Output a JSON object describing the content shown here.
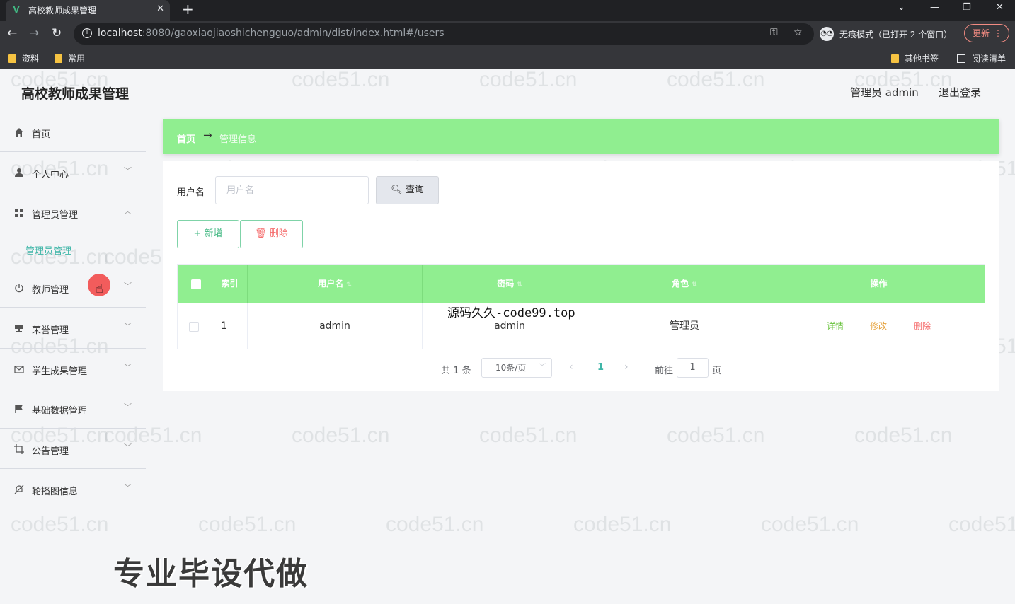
{
  "browser": {
    "tab_title": "高校教师成果管理",
    "tab_favicon": "V",
    "url_host": "localhost",
    "url_rest": ":8080/gaoxiaojiaoshichengguo/admin/dist/index.html#/users",
    "incognito_label": "无痕模式（已打开 2 个窗口）",
    "update_label": "更新",
    "bookmarks": [
      "资料",
      "常用",
      "其他书签",
      "阅读清单"
    ]
  },
  "header": {
    "title": "高校教师成果管理",
    "admin_label": "管理员 admin",
    "logout_label": "退出登录"
  },
  "sidebar": {
    "items": [
      {
        "label": "首页",
        "icon": "home-icon"
      },
      {
        "label": "个人中心",
        "icon": "user-icon"
      },
      {
        "label": "管理员管理",
        "icon": "grid-icon"
      },
      {
        "label": "教师管理",
        "icon": "power-icon"
      },
      {
        "label": "荣誉管理",
        "icon": "trophy-icon"
      },
      {
        "label": "学生成果管理",
        "icon": "mail-icon"
      },
      {
        "label": "基础数据管理",
        "icon": "flag-icon"
      },
      {
        "label": "公告管理",
        "icon": "crop-icon"
      },
      {
        "label": "轮播图信息",
        "icon": "bell-off-icon"
      }
    ],
    "sub_item": "管理员管理"
  },
  "breadcrumb": {
    "home": "首页",
    "arrow": "→",
    "current": "管理信息"
  },
  "search": {
    "label": "用户名",
    "placeholder": "用户名",
    "button": "查询"
  },
  "actions": {
    "add": "新增",
    "delete": "删除"
  },
  "table": {
    "columns": [
      "索引",
      "用户名",
      "密码",
      "角色",
      "操作"
    ],
    "rows": [
      {
        "index": "1",
        "username": "admin",
        "password": "admin",
        "role": "管理员"
      }
    ],
    "row_actions": {
      "detail": "详情",
      "edit": "修改",
      "delete": "删除"
    }
  },
  "pagination": {
    "total": "共 1 条",
    "page_size": "10条/页",
    "current_page": "1",
    "goto_prefix": "前往",
    "goto_value": "1",
    "goto_suffix": "页"
  },
  "overlay": {
    "caption": "源码久久-code99.top",
    "promo": "专业毕设代做",
    "watermark": "code51.cn"
  },
  "colors": {
    "accent_green": "#90ee90",
    "teal": "#3fb6a8",
    "danger": "#f56c6c",
    "warning": "#e6a23c",
    "success": "#67c23a"
  }
}
